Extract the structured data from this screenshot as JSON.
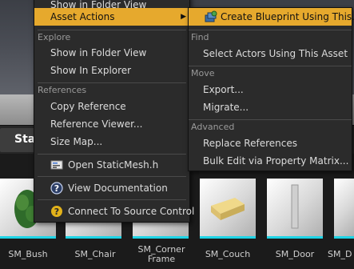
{
  "left_menu": {
    "top_item": "Show in Folder View",
    "asset_actions": "Asset Actions",
    "asset_actions_arrow": "▶",
    "sections": {
      "explore": "Explore",
      "references": "References"
    },
    "items": {
      "show_in_folder_view": "Show in Folder View",
      "show_in_explorer": "Show In Explorer",
      "copy_reference": "Copy Reference",
      "reference_viewer": "Reference Viewer...",
      "size_map": "Size Map...",
      "open_staticmesh_h": "Open StaticMesh.h",
      "view_documentation": "View Documentation",
      "connect_source_control": "Connect To Source Control"
    },
    "icons": {
      "open_staticmesh_h": "code-file-icon",
      "view_documentation": "help-icon",
      "connect_source_control": "source-control-icon"
    }
  },
  "right_menu": {
    "create_blueprint": "Create Blueprint Using This...",
    "sections": {
      "find": "Find",
      "move": "Move",
      "advanced": "Advanced"
    },
    "items": {
      "select_actors": "Select Actors Using This Asset",
      "export": "Export...",
      "migrate": "Migrate...",
      "replace_references": "Replace References",
      "bulk_edit": "Bulk Edit via Property Matrix..."
    },
    "icons": {
      "create_blueprint": "blueprint-icon"
    }
  },
  "content_browser": {
    "tab_label": "Sta",
    "assets": [
      {
        "name": "SM_Bush"
      },
      {
        "name": "SM_Chair"
      },
      {
        "name": "SM_Corner Frame"
      },
      {
        "name": "SM_Couch"
      },
      {
        "name": "SM_Door"
      },
      {
        "name": "SM_D"
      }
    ]
  },
  "colors": {
    "highlight": "#e6a92d",
    "menu_bg": "#2b2b2b",
    "asset_underline": "#1fd4e6"
  }
}
